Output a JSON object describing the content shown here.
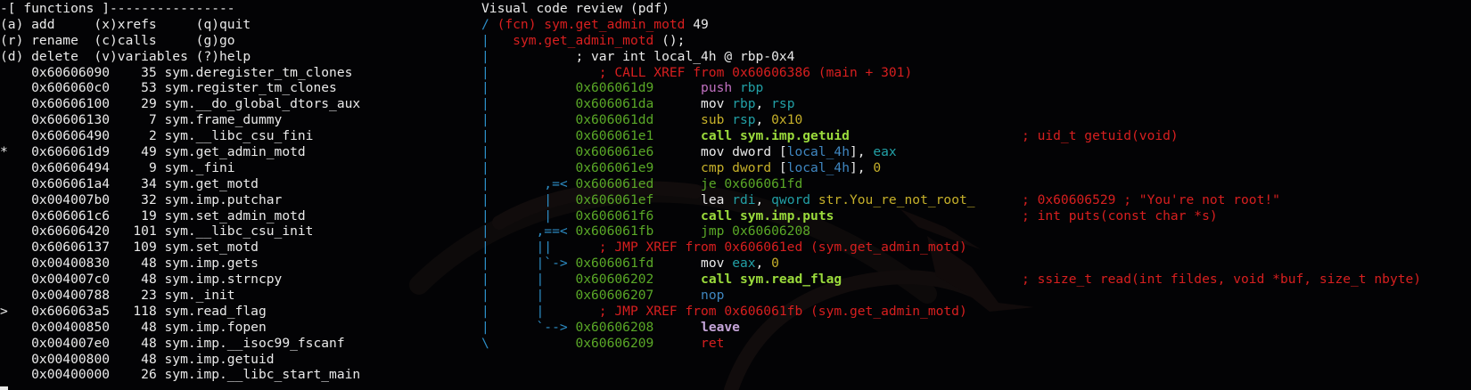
{
  "theme": {
    "background": "#030305",
    "text": "#eaeaea",
    "red": "#d81f1f",
    "green": "#5aa827",
    "yellow": "#c6b02a",
    "teal": "#22a0a6",
    "lime": "#9bdb3c",
    "purple": "#c4a4d8",
    "flow_blue": "#2d8ec7"
  },
  "functions_panel": {
    "header": "-[ functions ]----------------",
    "help_rows": [
      "(a) add     (x)xrefs     (q)quit",
      "(r) rename  (c)calls     (g)go",
      "(d) delete  (v)variables (?)help"
    ],
    "entries": [
      {
        "marker": " ",
        "address": "0x60606090",
        "size": "35",
        "name": "sym.deregister_tm_clones"
      },
      {
        "marker": " ",
        "address": "0x606060c0",
        "size": "53",
        "name": "sym.register_tm_clones"
      },
      {
        "marker": " ",
        "address": "0x60606100",
        "size": "29",
        "name": "sym.__do_global_dtors_aux"
      },
      {
        "marker": " ",
        "address": "0x60606130",
        "size": "7",
        "name": "sym.frame_dummy"
      },
      {
        "marker": " ",
        "address": "0x60606490",
        "size": "2",
        "name": "sym.__libc_csu_fini"
      },
      {
        "marker": "*",
        "address": "0x606061d9",
        "size": "49",
        "name": "sym.get_admin_motd"
      },
      {
        "marker": " ",
        "address": "0x60606494",
        "size": "9",
        "name": "sym._fini"
      },
      {
        "marker": " ",
        "address": "0x606061a4",
        "size": "34",
        "name": "sym.get_motd"
      },
      {
        "marker": " ",
        "address": "0x004007b0",
        "size": "32",
        "name": "sym.imp.putchar"
      },
      {
        "marker": " ",
        "address": "0x606061c6",
        "size": "19",
        "name": "sym.set_admin_motd"
      },
      {
        "marker": " ",
        "address": "0x60606420",
        "size": "101",
        "name": "sym.__libc_csu_init"
      },
      {
        "marker": " ",
        "address": "0x60606137",
        "size": "109",
        "name": "sym.set_motd"
      },
      {
        "marker": " ",
        "address": "0x00400830",
        "size": "48",
        "name": "sym.imp.gets"
      },
      {
        "marker": " ",
        "address": "0x004007c0",
        "size": "48",
        "name": "sym.imp.strncpy"
      },
      {
        "marker": " ",
        "address": "0x00400788",
        "size": "23",
        "name": "sym._init"
      },
      {
        "marker": ">",
        "address": "0x606063a5",
        "size": "118",
        "name": "sym.read_flag"
      },
      {
        "marker": " ",
        "address": "0x00400850",
        "size": "48",
        "name": "sym.imp.fopen"
      },
      {
        "marker": " ",
        "address": "0x004007e0",
        "size": "48",
        "name": "sym.imp.__isoc99_fscanf"
      },
      {
        "marker": " ",
        "address": "0x00400800",
        "size": "48",
        "name": "sym.imp.getuid"
      },
      {
        "marker": " ",
        "address": "0x00400000",
        "size": "26",
        "name": "sym.imp.__libc_start_main"
      }
    ]
  },
  "code_panel": {
    "title": "Visual code review (pdf)",
    "lines": [
      {
        "flow": "/ ",
        "segments": [
          {
            "t": "(fcn) sym.get_admin_motd ",
            "c": "red"
          },
          {
            "t": "49",
            "c": "white"
          }
        ]
      },
      {
        "flow": "|   ",
        "segments": [
          {
            "t": "sym.get_admin_motd ",
            "c": "red"
          },
          {
            "t": "();",
            "c": "white"
          }
        ]
      },
      {
        "flow": "|           ",
        "segments": [
          {
            "t": "; var int local_4h @ rbp-0x4",
            "c": "white"
          }
        ]
      },
      {
        "flow": "|              ",
        "segments": [
          {
            "t": "; CALL XREF from 0x60606386 (main + 301)",
            "c": "red"
          }
        ]
      },
      {
        "flow": "|           ",
        "segments": [
          {
            "t": "0x606061d9",
            "c": "green"
          },
          {
            "t": "      ",
            "c": "white"
          },
          {
            "t": "push ",
            "c": "magenta"
          },
          {
            "t": "rbp",
            "c": "teal"
          }
        ]
      },
      {
        "flow": "|           ",
        "segments": [
          {
            "t": "0x606061da",
            "c": "green"
          },
          {
            "t": "      mov ",
            "c": "white"
          },
          {
            "t": "rbp",
            "c": "teal"
          },
          {
            "t": ", ",
            "c": "white"
          },
          {
            "t": "rsp",
            "c": "teal"
          }
        ]
      },
      {
        "flow": "|           ",
        "segments": [
          {
            "t": "0x606061dd",
            "c": "green"
          },
          {
            "t": "      ",
            "c": "white"
          },
          {
            "t": "sub ",
            "c": "yellow"
          },
          {
            "t": "rsp",
            "c": "teal"
          },
          {
            "t": ", ",
            "c": "white"
          },
          {
            "t": "0x10",
            "c": "yellow"
          }
        ]
      },
      {
        "flow": "|           ",
        "segments": [
          {
            "t": "0x606061e1",
            "c": "green"
          },
          {
            "t": "      ",
            "c": "white"
          },
          {
            "t": "call sym.imp.getuid",
            "c": "lime"
          }
        ],
        "comment": "; uid_t getuid(void)"
      },
      {
        "flow": "|           ",
        "segments": [
          {
            "t": "0x606061e6",
            "c": "green"
          },
          {
            "t": "      mov dword [",
            "c": "white"
          },
          {
            "t": "local_4h",
            "c": "dim"
          },
          {
            "t": "], ",
            "c": "white"
          },
          {
            "t": "eax",
            "c": "teal"
          }
        ]
      },
      {
        "flow": "|           ",
        "segments": [
          {
            "t": "0x606061e9",
            "c": "green"
          },
          {
            "t": "      ",
            "c": "white"
          },
          {
            "t": "cmp dword ",
            "c": "yellow"
          },
          {
            "t": "[",
            "c": "white"
          },
          {
            "t": "local_4h",
            "c": "dim"
          },
          {
            "t": "], ",
            "c": "white"
          },
          {
            "t": "0",
            "c": "yellow"
          }
        ]
      },
      {
        "flow": "|       ,=< ",
        "segments": [
          {
            "t": "0x606061ed",
            "c": "green"
          },
          {
            "t": "      ",
            "c": "white"
          },
          {
            "t": "je 0x606061fd",
            "c": "green"
          }
        ]
      },
      {
        "flow": "|       |   ",
        "segments": [
          {
            "t": "0x606061ef",
            "c": "green"
          },
          {
            "t": "      lea ",
            "c": "white"
          },
          {
            "t": "rdi",
            "c": "teal"
          },
          {
            "t": ", ",
            "c": "white"
          },
          {
            "t": "qword ",
            "c": "teal"
          },
          {
            "t": "str.You_re_not_root_",
            "c": "yellow"
          }
        ],
        "comment": "; 0x60606529 ; \"You're not root!\""
      },
      {
        "flow": "|       |   ",
        "segments": [
          {
            "t": "0x606061f6",
            "c": "green"
          },
          {
            "t": "      ",
            "c": "white"
          },
          {
            "t": "call sym.imp.puts",
            "c": "lime"
          }
        ],
        "comment": "; int puts(const char *s)"
      },
      {
        "flow": "|      ,==< ",
        "segments": [
          {
            "t": "0x606061fb",
            "c": "green"
          },
          {
            "t": "      ",
            "c": "white"
          },
          {
            "t": "jmp 0x60606208",
            "c": "green"
          }
        ]
      },
      {
        "flow": "|      ||      ",
        "segments": [
          {
            "t": "; JMP XREF from 0x606061ed (sym.get_admin_motd)",
            "c": "red"
          }
        ]
      },
      {
        "flow": "|      |`-> ",
        "segments": [
          {
            "t": "0x606061fd",
            "c": "green"
          },
          {
            "t": "      mov ",
            "c": "white"
          },
          {
            "t": "eax",
            "c": "teal"
          },
          {
            "t": ", ",
            "c": "white"
          },
          {
            "t": "0",
            "c": "yellow"
          }
        ]
      },
      {
        "flow": "|      |    ",
        "segments": [
          {
            "t": "0x60606202",
            "c": "green"
          },
          {
            "t": "      ",
            "c": "white"
          },
          {
            "t": "call sym.read_flag",
            "c": "lime"
          }
        ],
        "comment": "; ssize_t read(int fildes, void *buf, size_t nbyte)"
      },
      {
        "flow": "|      |    ",
        "segments": [
          {
            "t": "0x60606207",
            "c": "green"
          },
          {
            "t": "      ",
            "c": "white"
          },
          {
            "t": "nop",
            "c": "dim"
          }
        ]
      },
      {
        "flow": "|      |       ",
        "segments": [
          {
            "t": "; JMP XREF from 0x606061fb (sym.get_admin_motd)",
            "c": "red"
          }
        ]
      },
      {
        "flow": "|      `--> ",
        "segments": [
          {
            "t": "0x60606208",
            "c": "green"
          },
          {
            "t": "      ",
            "c": "white"
          },
          {
            "t": "leave",
            "c": "purple"
          }
        ]
      },
      {
        "flow": "\\           ",
        "segments": [
          {
            "t": "0x60606209",
            "c": "green"
          },
          {
            "t": "      ",
            "c": "white"
          },
          {
            "t": "ret",
            "c": "red"
          }
        ]
      }
    ]
  }
}
